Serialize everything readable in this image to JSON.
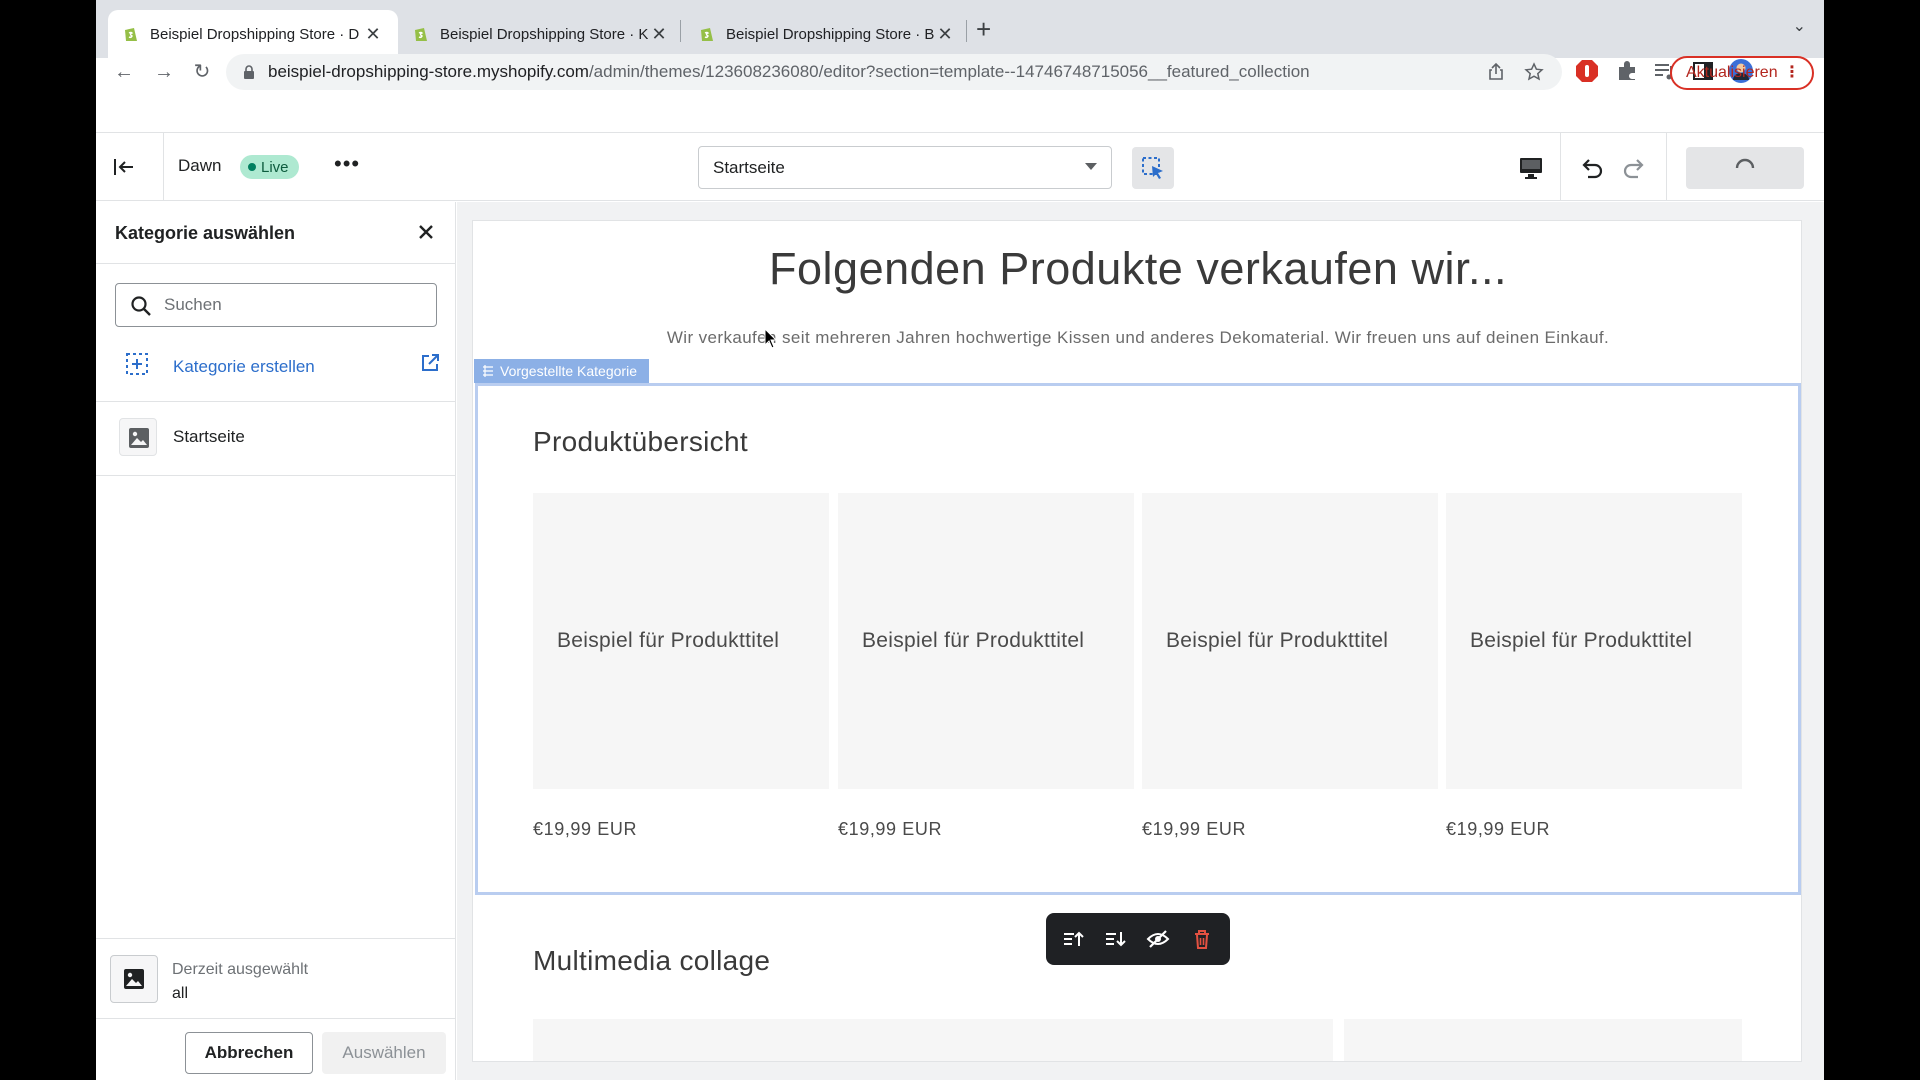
{
  "browser": {
    "tabs": [
      {
        "title": "Beispiel Dropshipping Store · D",
        "active": true
      },
      {
        "title": "Beispiel Dropshipping Store · K",
        "active": false
      },
      {
        "title": "Beispiel Dropshipping Store · B",
        "active": false
      }
    ],
    "url_host": "beispiel-dropshipping-store.myshopify.com",
    "url_path": "/admin/themes/123608236080/editor?section=template--14746748715056__featured_collection",
    "update_label": "Aktualisieren",
    "colors": {
      "accent_red": "#d93025",
      "shopify_green": "#95bf47"
    }
  },
  "editor": {
    "theme_name": "Dawn",
    "live_badge": "Live",
    "page_select": "Startseite"
  },
  "panel": {
    "title": "Kategorie auswählen",
    "search_placeholder": "Suchen",
    "create_label": "Kategorie erstellen",
    "items": [
      {
        "label": "Startseite"
      }
    ],
    "current_label": "Derzeit ausgewählt",
    "current_value": "all",
    "cancel_label": "Abbrechen",
    "select_label": "Auswählen"
  },
  "preview": {
    "heading": "Folgenden Produkte verkaufen wir...",
    "text": "Wir verkaufen seit mehreren Jahren hochwertige Kissen und anderes Dekomaterial. Wir freuen uns auf deinen Einkauf.",
    "section_tag": "Vorgestellte Kategorie",
    "section_title": "Produktübersicht",
    "products": [
      {
        "title": "Beispiel für Produkttitel",
        "price": "€19,99 EUR"
      },
      {
        "title": "Beispiel für Produkttitel",
        "price": "€19,99 EUR"
      },
      {
        "title": "Beispiel für Produkttitel",
        "price": "€19,99 EUR"
      },
      {
        "title": "Beispiel für Produkttitel",
        "price": "€19,99 EUR"
      }
    ],
    "next_section_title": "Multimedia collage"
  }
}
